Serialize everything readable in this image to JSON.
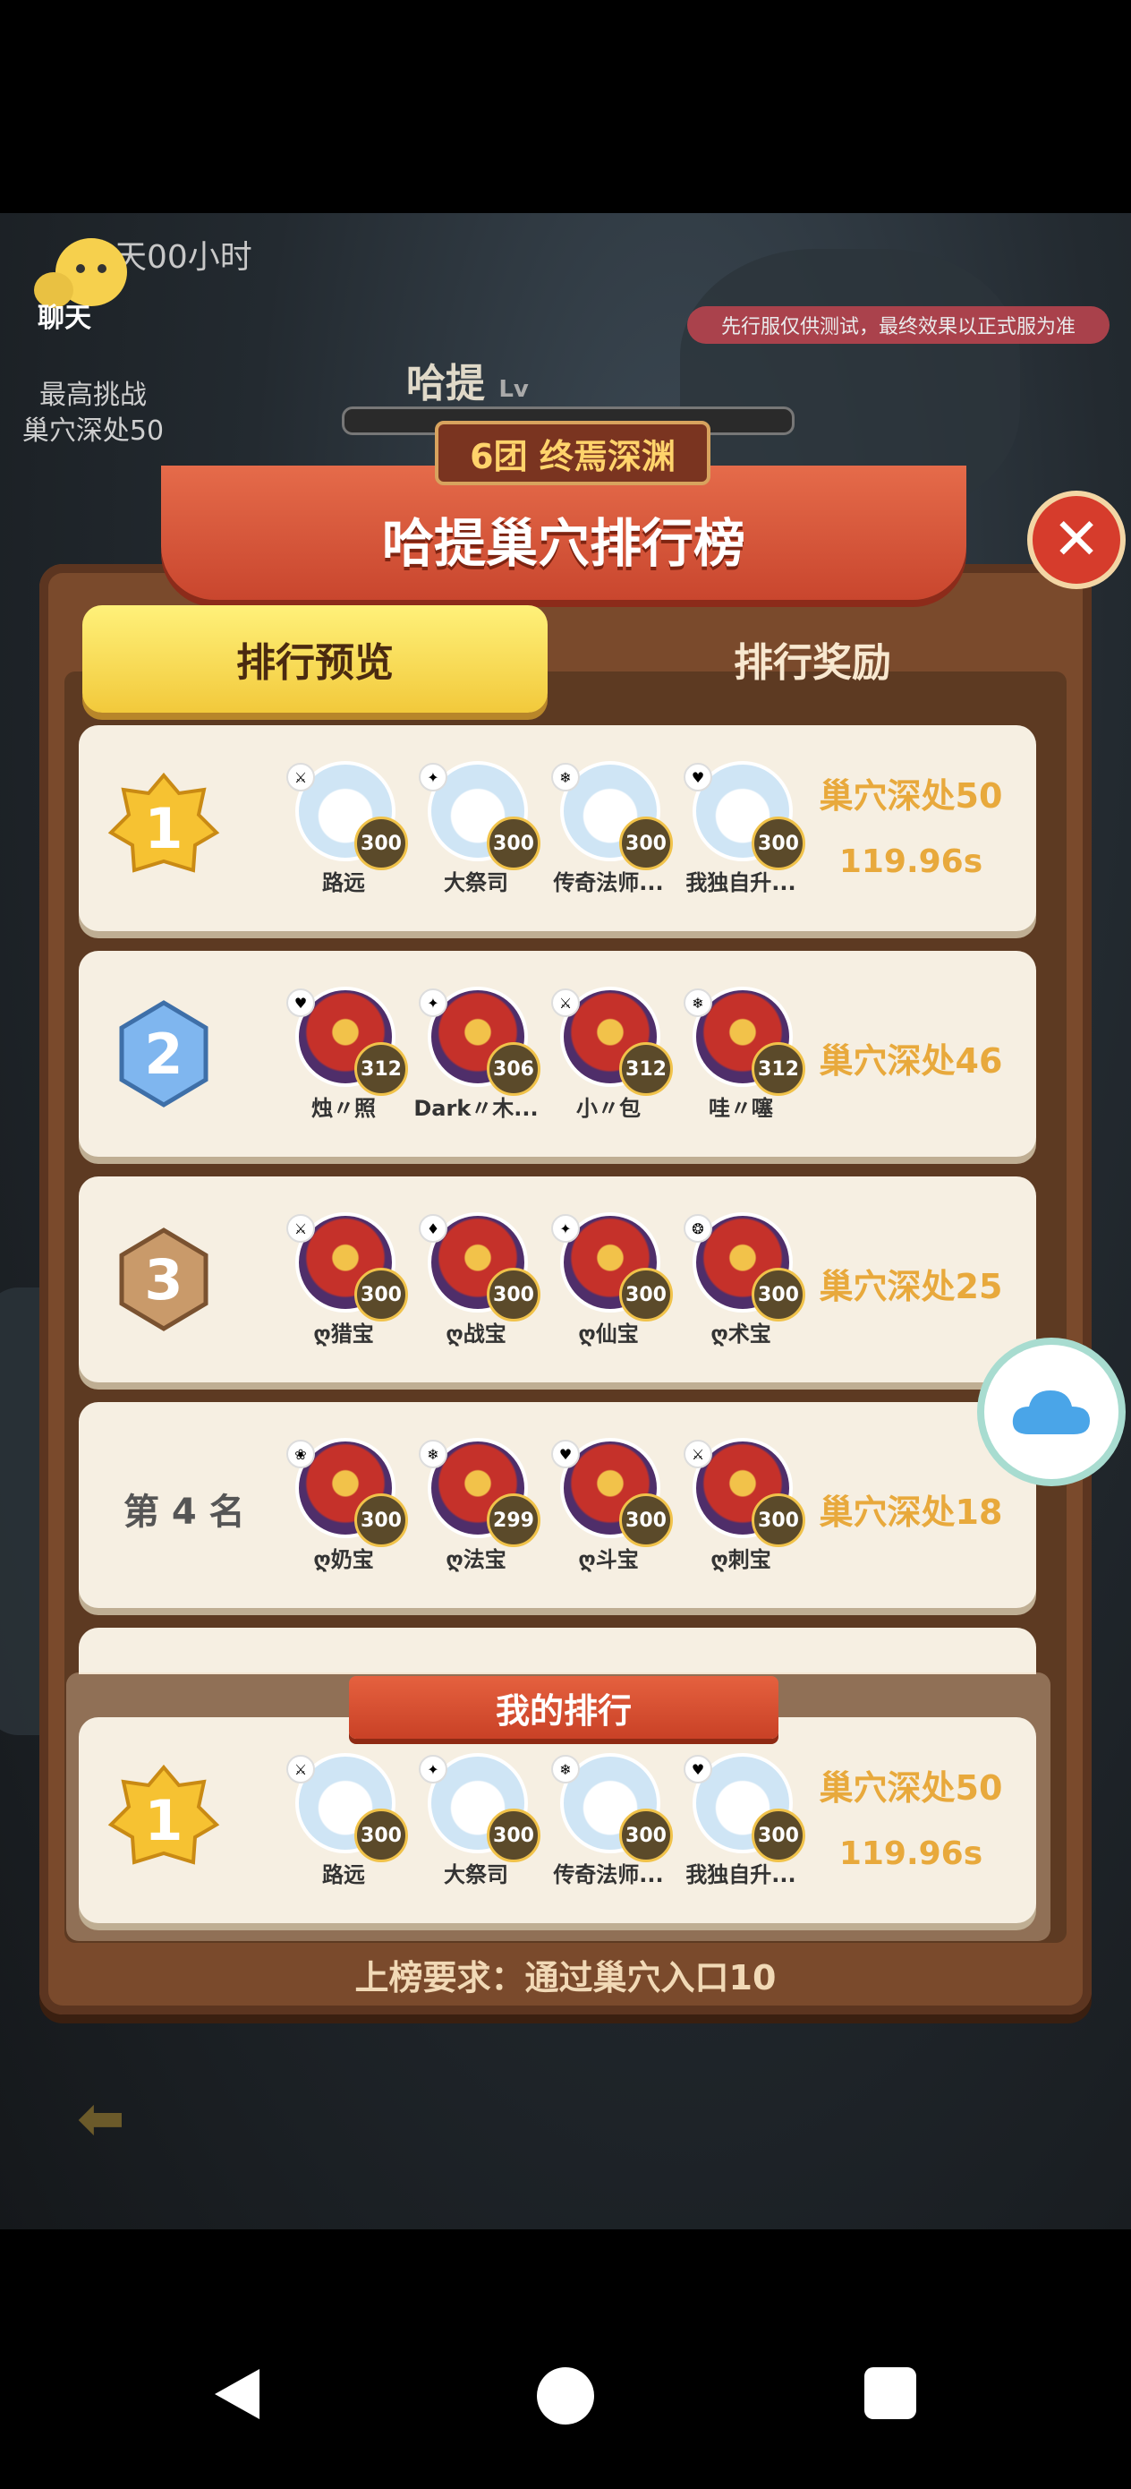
{
  "hud": {
    "timer": "天00小时",
    "chat_label": "聊天",
    "notice": "先行服仅供测试，最终效果以正式服为准",
    "high_score_title": "最高挑战",
    "high_score_value": "巢穴深处50",
    "hero_name": "哈提",
    "hero_level": "Lv"
  },
  "board": {
    "subtitle": "6团 终焉深渊",
    "title": "哈提巢穴排行榜",
    "tabs": [
      {
        "label": "排行预览",
        "active": true
      },
      {
        "label": "排行奖励",
        "active": false
      }
    ]
  },
  "ranks": [
    {
      "rank": "1",
      "members": [
        {
          "name": "路远",
          "level": "300",
          "avatar": "snow"
        },
        {
          "name": "大祭司",
          "level": "300",
          "avatar": "snow"
        },
        {
          "name": "传奇法师...",
          "level": "300",
          "avatar": "snow"
        },
        {
          "name": "我独自升...",
          "level": "300",
          "avatar": "snow"
        }
      ],
      "score": "巢穴深处50",
      "time": "119.96s"
    },
    {
      "rank": "2",
      "members": [
        {
          "name": "烛〃照",
          "level": "312",
          "avatar": "hero"
        },
        {
          "name": "Dark〃木...",
          "level": "306",
          "avatar": "hero"
        },
        {
          "name": "小〃包",
          "level": "312",
          "avatar": "hero"
        },
        {
          "name": "哇〃噻",
          "level": "312",
          "avatar": "hero"
        }
      ],
      "score": "巢穴深处46"
    },
    {
      "rank": "3",
      "members": [
        {
          "name": "ღ猎宝",
          "level": "300",
          "avatar": "hero"
        },
        {
          "name": "ღ战宝",
          "level": "300",
          "avatar": "hero"
        },
        {
          "name": "ღ仙宝",
          "level": "300",
          "avatar": "hero"
        },
        {
          "name": "ღ术宝",
          "level": "300",
          "avatar": "hero"
        }
      ],
      "score": "巢穴深处25"
    },
    {
      "rank_label": "第 4 名",
      "members": [
        {
          "name": "ღ奶宝",
          "level": "300",
          "avatar": "hero"
        },
        {
          "name": "ღ法宝",
          "level": "299",
          "avatar": "hero"
        },
        {
          "name": "ღ斗宝",
          "level": "300",
          "avatar": "hero"
        },
        {
          "name": "ღ刺宝",
          "level": "300",
          "avatar": "hero"
        }
      ],
      "score": "巢穴深处18"
    }
  ],
  "my_rank": {
    "label": "我的排行",
    "rank": "1",
    "members": [
      {
        "name": "路远",
        "level": "300"
      },
      {
        "name": "大祭司",
        "level": "300"
      },
      {
        "name": "传奇法师...",
        "level": "300"
      },
      {
        "name": "我独自升...",
        "level": "300"
      }
    ],
    "score": "巢穴深处50",
    "time": "119.96s"
  },
  "requirement": "上榜要求：通过巢穴入口10",
  "colors": {
    "gold": "#e8a93c",
    "ribbon": "#c94126",
    "card": "#f6efe2",
    "wood": "#7a4a2c"
  }
}
